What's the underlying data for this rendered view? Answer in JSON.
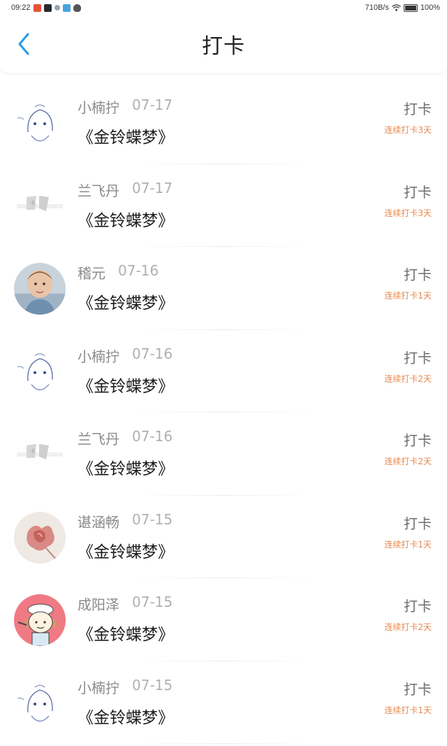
{
  "status": {
    "time": "09:22",
    "speed": "710B/s",
    "battery": "100%"
  },
  "header": {
    "title": "打卡"
  },
  "items": [
    {
      "user": "小楠拧",
      "date": "07-17",
      "book": "《金铃蝶梦》",
      "action": "打卡",
      "streak": "连续打卡3天"
    },
    {
      "user": "兰飞丹",
      "date": "07-17",
      "book": "《金铃蝶梦》",
      "action": "打卡",
      "streak": "连续打卡3天"
    },
    {
      "user": "稽元",
      "date": "07-16",
      "book": "《金铃蝶梦》",
      "action": "打卡",
      "streak": "连续打卡1天"
    },
    {
      "user": "小楠拧",
      "date": "07-16",
      "book": "《金铃蝶梦》",
      "action": "打卡",
      "streak": "连续打卡2天"
    },
    {
      "user": "兰飞丹",
      "date": "07-16",
      "book": "《金铃蝶梦》",
      "action": "打卡",
      "streak": "连续打卡2天"
    },
    {
      "user": "谌涵畅",
      "date": "07-15",
      "book": "《金铃蝶梦》",
      "action": "打卡",
      "streak": "连续打卡1天"
    },
    {
      "user": "成阳泽",
      "date": "07-15",
      "book": "《金铃蝶梦》",
      "action": "打卡",
      "streak": "连续打卡2天"
    },
    {
      "user": "小楠拧",
      "date": "07-15",
      "book": "《金铃蝶梦》",
      "action": "打卡",
      "streak": "连续打卡1天"
    }
  ]
}
